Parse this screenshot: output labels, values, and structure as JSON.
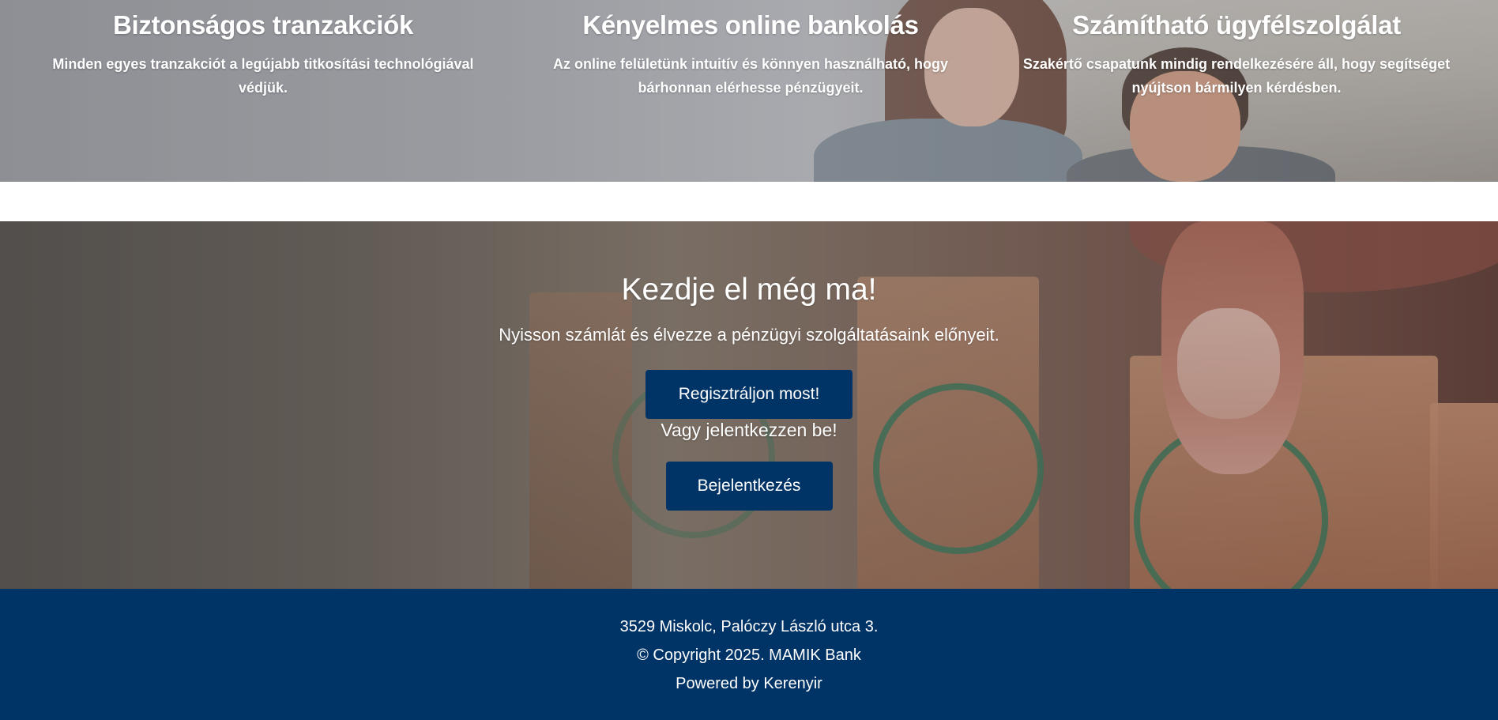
{
  "features": [
    {
      "title": "Biztonságos tranzakciók",
      "text": "Minden egyes tranzakciót a legújabb titkosítási technológiával védjük."
    },
    {
      "title": "Kényelmes online bankolás",
      "text": "Az online felületünk intuitív és könnyen használható, hogy bárhonnan elérhesse pénzügyeit."
    },
    {
      "title": "Számítható ügyfélszolgálat",
      "text": "Szakértő csapatunk mindig rendelkezésére áll, hogy segítséget nyújtson bármilyen kérdésben."
    }
  ],
  "cta": {
    "title": "Kezdje el még ma!",
    "subtitle": "Nyisson számlát és élvezze a pénzügyi szolgáltatásaink előnyeit.",
    "register_label": "Regisztráljon most!",
    "or_text": "Vagy jelentkezzen be!",
    "login_label": "Bejelentkezés"
  },
  "footer": {
    "address": "3529 Miskolc, Palóczy László utca 3.",
    "copyright": "© Copyright 2025. MAMIK Bank",
    "powered": "Powered by Kerenyir"
  },
  "colors": {
    "primary": "#003366",
    "text_light": "#ffffff"
  }
}
